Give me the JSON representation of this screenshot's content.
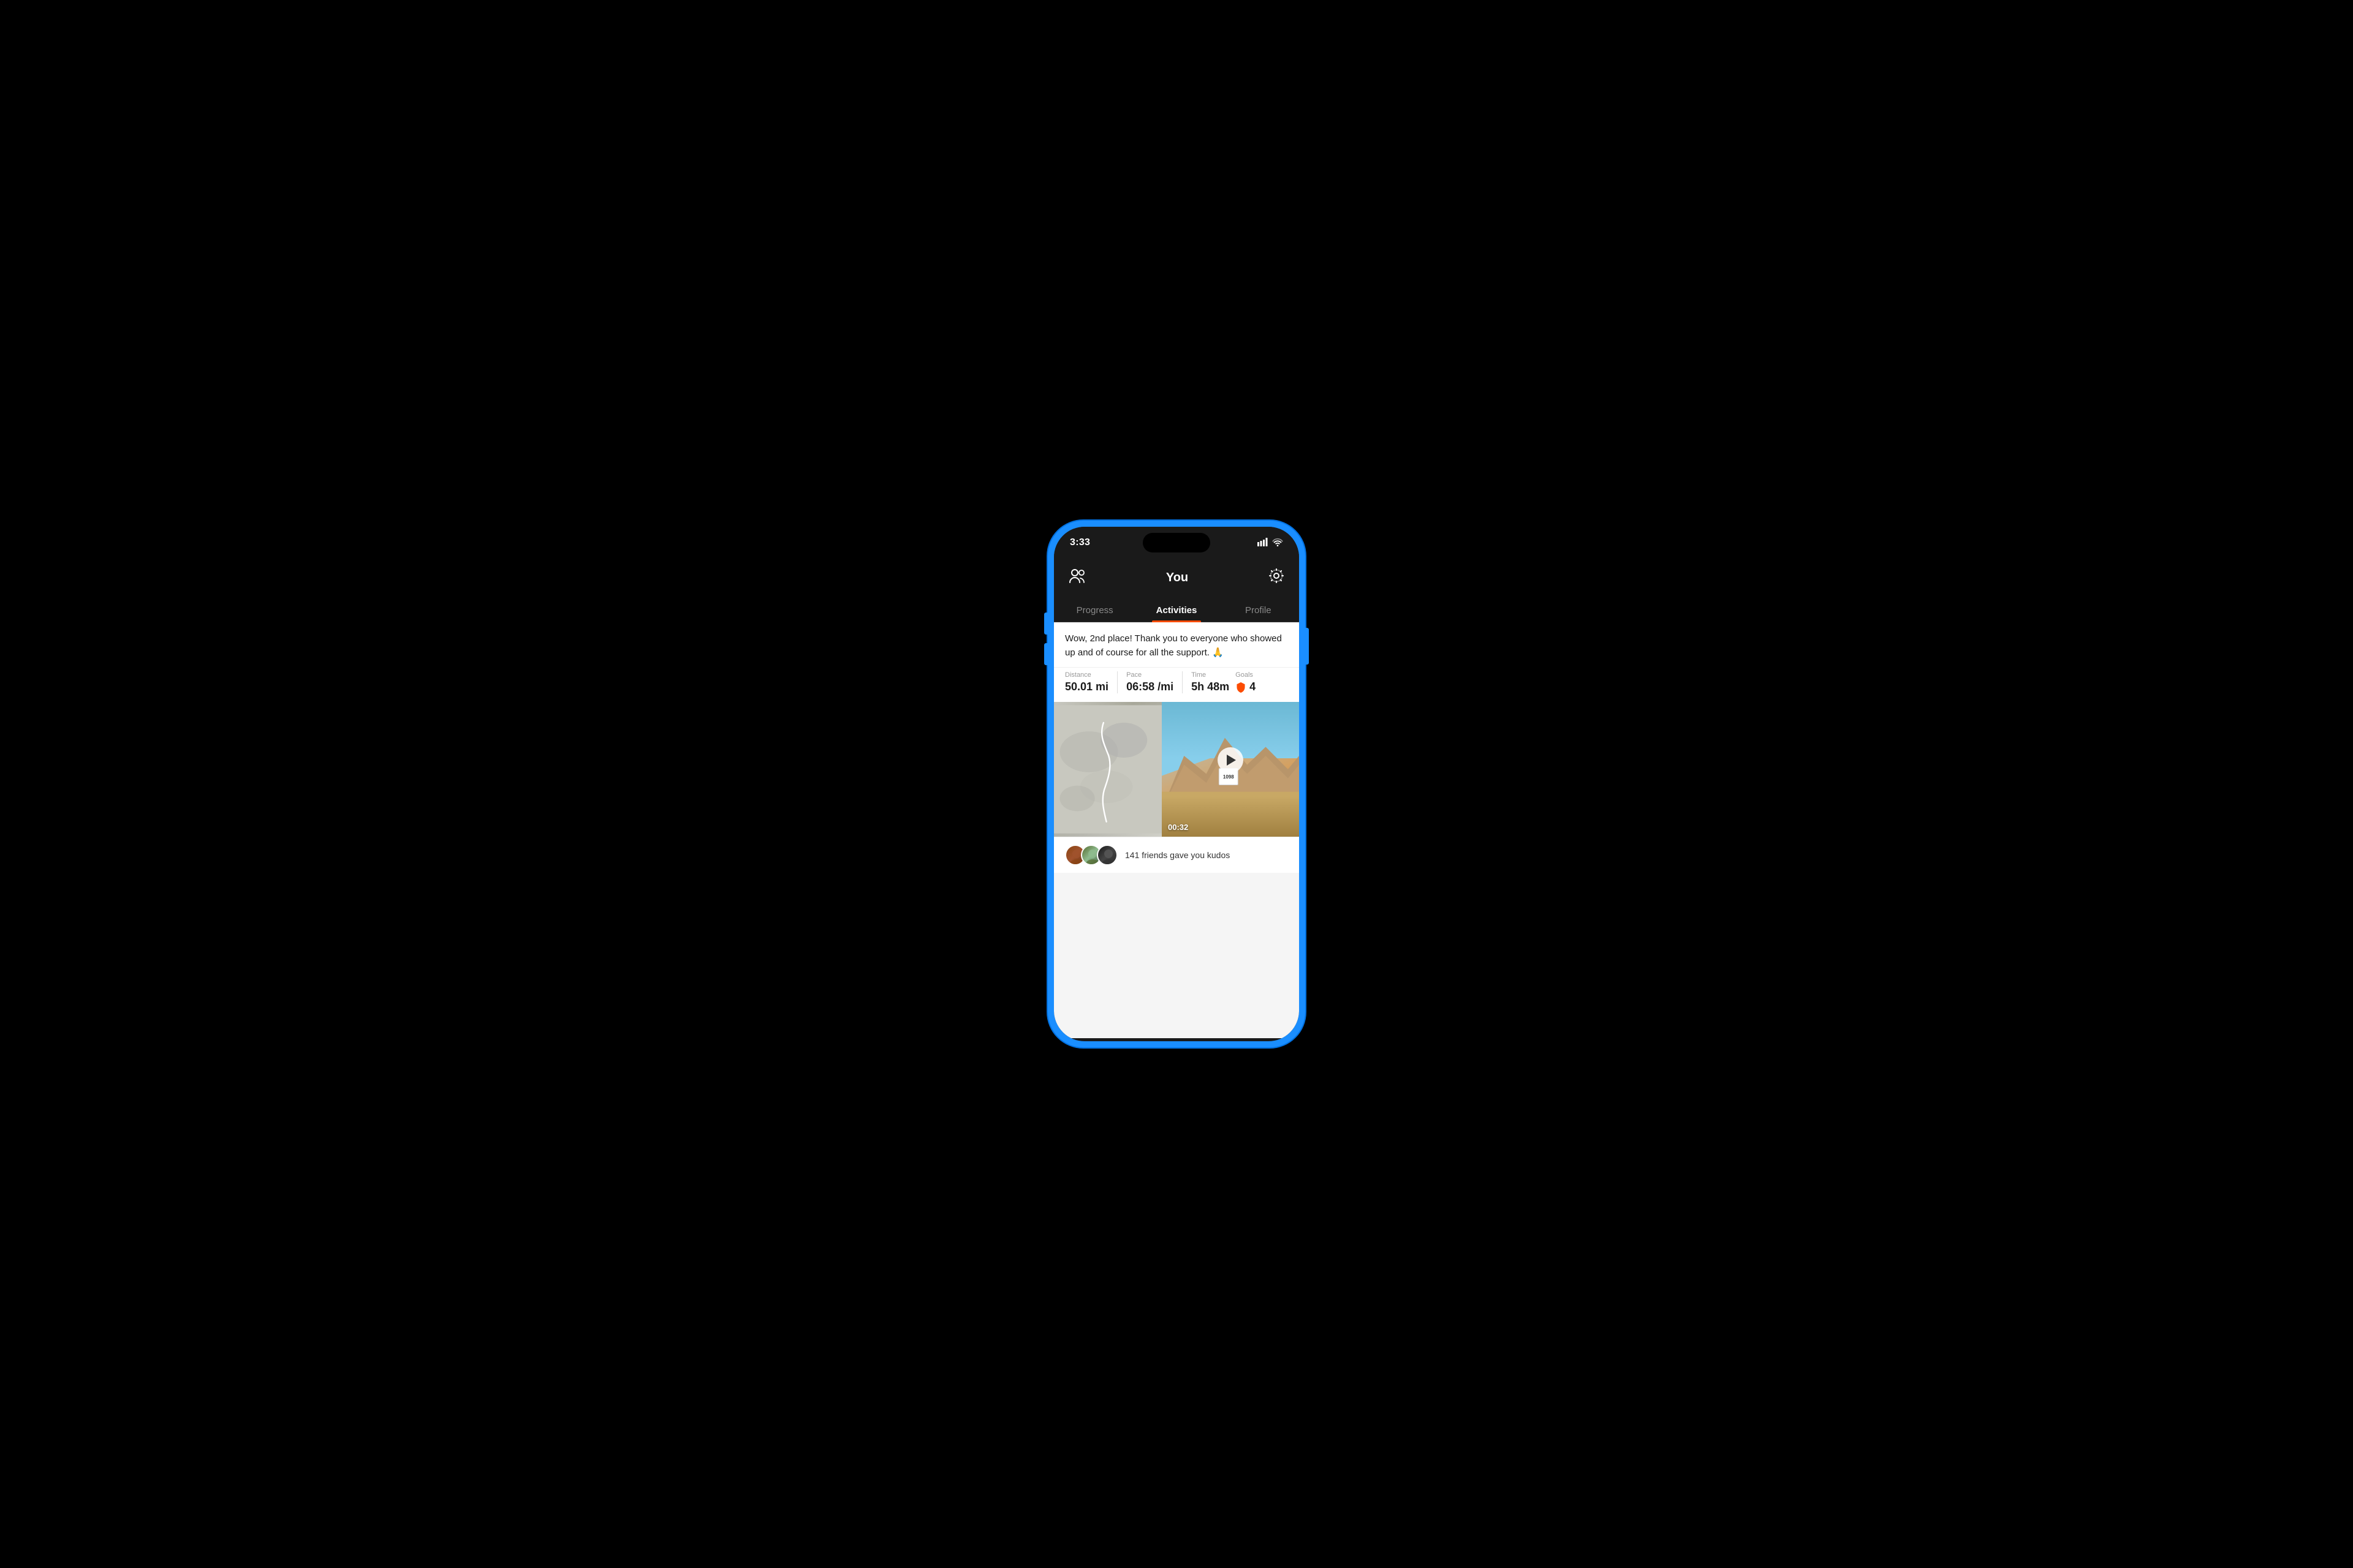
{
  "phone": {
    "status_bar": {
      "time": "3:33",
      "signal_bars": "▋▋▋▋",
      "wifi": "wifi"
    },
    "header": {
      "title": "You",
      "friends_icon": "friends",
      "settings_icon": "gear"
    },
    "tabs": [
      {
        "id": "progress",
        "label": "Progress",
        "active": false
      },
      {
        "id": "activities",
        "label": "Activities",
        "active": true
      },
      {
        "id": "profile",
        "label": "Profile",
        "active": false
      }
    ],
    "activity": {
      "post_text": "Wow, 2nd place! Thank you to everyone who showed up and of course for all the support. 🙏",
      "stats": {
        "distance": {
          "label": "Distance",
          "value": "50.01 mi"
        },
        "pace": {
          "label": "Pace",
          "value": "06:58 /mi"
        },
        "time": {
          "label": "Time",
          "value": "5h 48m"
        },
        "goals": {
          "label": "Goals",
          "value": "4"
        }
      },
      "video_duration": "00:32",
      "kudos_count": "141 friends gave you kudos"
    }
  }
}
